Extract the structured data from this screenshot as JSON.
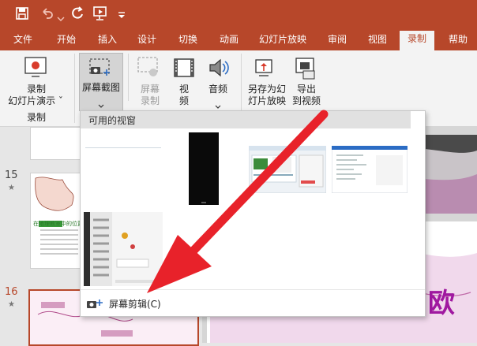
{
  "quick_access": {
    "save_icon": "save-icon",
    "undo_icon": "undo-icon",
    "redo_icon": "redo-icon",
    "from_start_icon": "present-from-start-icon",
    "customize_icon": "customize-toolbar-icon"
  },
  "tabs": [
    "文件",
    "开始",
    "插入",
    "设计",
    "切换",
    "动画",
    "幻灯片放映",
    "审阅",
    "视图",
    "录制",
    "帮助"
  ],
  "active_tab": "录制",
  "ribbon": {
    "record_line1": "录制",
    "record_line2": "幻灯片演示 ˇ",
    "group_record": "录制",
    "screenshot": "屏幕截图",
    "screen_record_1": "屏幕",
    "screen_record_2": "录制",
    "video_1": "视",
    "video_2": "频",
    "audio": "音频",
    "save_as_show_1": "另存为幻",
    "save_as_show_2": "灯片放映",
    "export_video_1": "导出",
    "export_video_2": "到视频"
  },
  "dropdown": {
    "header": "可用的视窗",
    "clip_label": "屏幕剪辑(C)"
  },
  "slides": {
    "n15": "15",
    "n16": "16",
    "star": "★",
    "slide15_text": "在地理教室中的位置"
  },
  "canvas": {
    "big_char": "欧"
  },
  "colors": {
    "brand": "#b7472a",
    "arrow": "#e8222a"
  }
}
